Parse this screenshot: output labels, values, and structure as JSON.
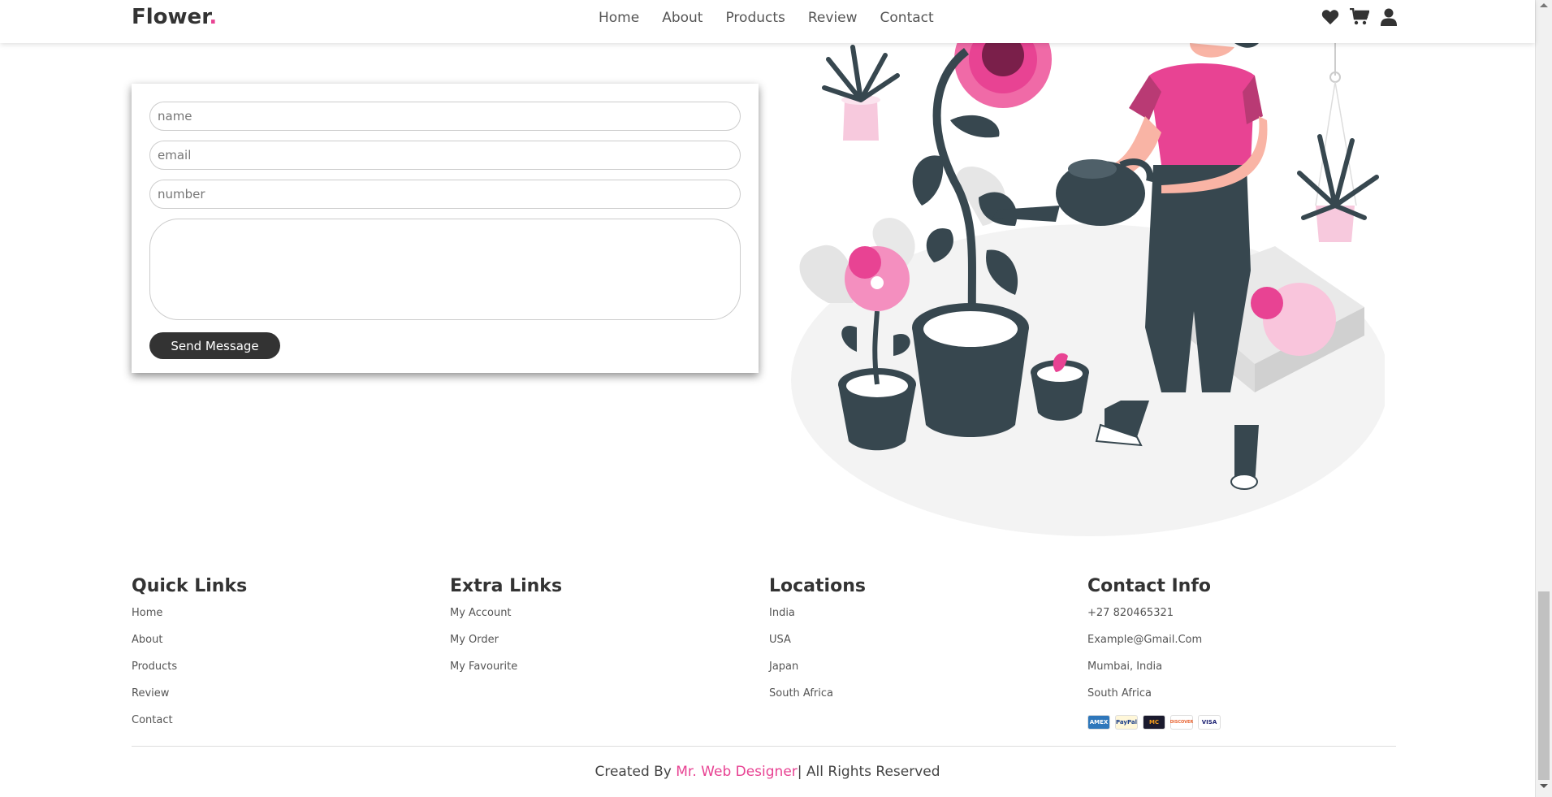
{
  "header": {
    "logo_text": "Flower",
    "logo_dot": ".",
    "nav": [
      "Home",
      "About",
      "Products",
      "Review",
      "Contact"
    ],
    "icons": [
      "heart-icon",
      "cart-icon",
      "user-icon"
    ]
  },
  "form": {
    "name_placeholder": "name",
    "email_placeholder": "email",
    "number_placeholder": "number",
    "message_placeholder": "",
    "send_label": "Send Message"
  },
  "footer": {
    "quick_links": {
      "title": "Quick Links",
      "items": [
        "Home",
        "About",
        "Products",
        "Review",
        "Contact"
      ]
    },
    "extra_links": {
      "title": "Extra Links",
      "items": [
        "My Account",
        "My Order",
        "My Favourite"
      ]
    },
    "locations": {
      "title": "Locations",
      "items": [
        "India",
        "USA",
        "Japan",
        "South Africa"
      ]
    },
    "contact_info": {
      "title": "Contact Info",
      "items": [
        "+27 820465321",
        "Example@Gmail.Com",
        "Mumbai, India",
        "South Africa"
      ]
    },
    "payment_cards": [
      "AMEX",
      "PayPal",
      "MC",
      "DISCOVER",
      "VISA"
    ]
  },
  "credit": {
    "prefix": "Created By ",
    "author": "Mr. Web Designer",
    "suffix": "| All Rights Reserved"
  },
  "colors": {
    "accent": "#e84393",
    "dark": "#333333",
    "plant": "#37474f"
  }
}
